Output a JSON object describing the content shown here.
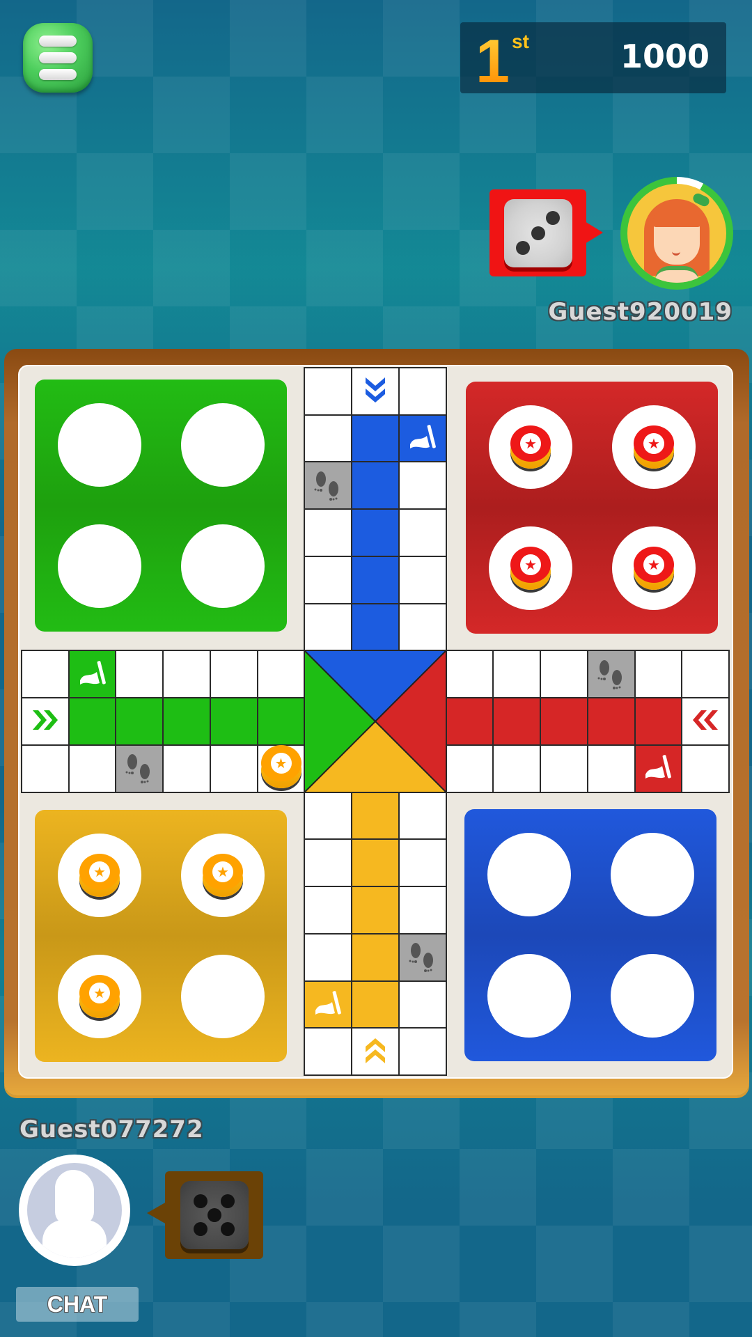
{
  "header": {
    "menu_icon": "hamburger-menu-icon",
    "rank_number": "1",
    "rank_suffix": "st",
    "score": "1000"
  },
  "opponent": {
    "name": "Guest920019",
    "avatar": "girl-avatar",
    "dice_value": 3,
    "dice_color": "#f01414",
    "turn_timer_remaining": 0.92
  },
  "player": {
    "name": "Guest077272",
    "avatar": "default-silhouette-avatar",
    "dice_value": 5,
    "dice_color": "#6b4206",
    "chat_label": "CHAT"
  },
  "board": {
    "colors": {
      "green": "#1ebe14",
      "red": "#d62626",
      "blue": "#1c5ce0",
      "yellow": "#f6b820",
      "safe": "#a6a6a6"
    },
    "homes": [
      {
        "color": "green",
        "tokens_in_home": [
          false,
          false,
          false,
          false
        ]
      },
      {
        "color": "red",
        "tokens_in_home": [
          true,
          true,
          true,
          true
        ]
      },
      {
        "color": "yellow",
        "tokens_in_home": [
          true,
          true,
          true,
          false
        ]
      },
      {
        "color": "blue",
        "tokens_in_home": [
          false,
          false,
          false,
          false
        ]
      }
    ],
    "tokens_on_track": [
      {
        "color": "yellow",
        "row": 8,
        "col": 5
      }
    ],
    "start_flags": [
      {
        "color": "green",
        "row": 6,
        "col": 1,
        "icon": "flag-icon"
      },
      {
        "color": "blue",
        "row": 1,
        "col": 8,
        "icon": "flag-icon"
      },
      {
        "color": "red",
        "row": 8,
        "col": 13,
        "icon": "flag-icon"
      },
      {
        "color": "yellow",
        "row": 13,
        "col": 6,
        "icon": "flag-icon"
      }
    ],
    "safe_spots": [
      {
        "row": 2,
        "col": 6,
        "icon": "footprints-icon"
      },
      {
        "row": 6,
        "col": 12,
        "icon": "footprints-icon"
      },
      {
        "row": 8,
        "col": 2,
        "icon": "footprints-icon"
      },
      {
        "row": 12,
        "col": 8,
        "icon": "footprints-icon"
      }
    ],
    "entry_arrows": [
      {
        "color": "blue",
        "row": 0,
        "col": 7,
        "glyph": "⌄⌄",
        "direction": "down"
      },
      {
        "color": "green",
        "row": 7,
        "col": 0,
        "glyph": "»",
        "direction": "right"
      },
      {
        "color": "red",
        "row": 7,
        "col": 14,
        "glyph": "«",
        "direction": "left"
      },
      {
        "color": "yellow",
        "row": 14,
        "col": 7,
        "glyph": "⌃⌃",
        "direction": "up"
      }
    ]
  }
}
